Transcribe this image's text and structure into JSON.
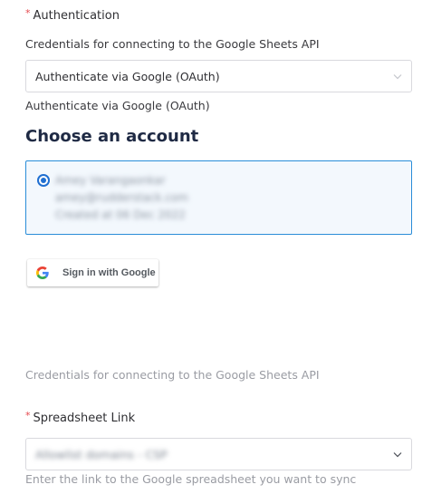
{
  "authentication": {
    "label": "Authentication",
    "required_mark": "*",
    "help_text": "Credentials for connecting to the Google Sheets API",
    "select_value": "Authenticate via Google (OAuth)",
    "method_caption": "Authenticate via Google (OAuth)"
  },
  "account_chooser": {
    "title": "Choose an account",
    "accounts": [
      {
        "name": "Amey Varangaonkar",
        "email": "amey@rudderstack.com",
        "created": "Created at 06 Dec 2022",
        "selected": true
      }
    ]
  },
  "google_button": {
    "label": "Sign in with Google"
  },
  "footer_help": "Credentials for connecting to the Google Sheets API",
  "spreadsheet": {
    "label": "Spreadsheet Link",
    "required_mark": "*",
    "select_value": "Allowlist domains - CSP",
    "help_text": "Enter the link to the Google spreadsheet you want to sync"
  },
  "colors": {
    "accent": "#2a8dd8",
    "radio": "#1f6fd1",
    "required": "#e5484d",
    "title": "#1f2a44",
    "muted": "#9a9ca3"
  },
  "icons": {
    "select_arrow": "chevron-down-icon",
    "google": "google-g-icon"
  }
}
